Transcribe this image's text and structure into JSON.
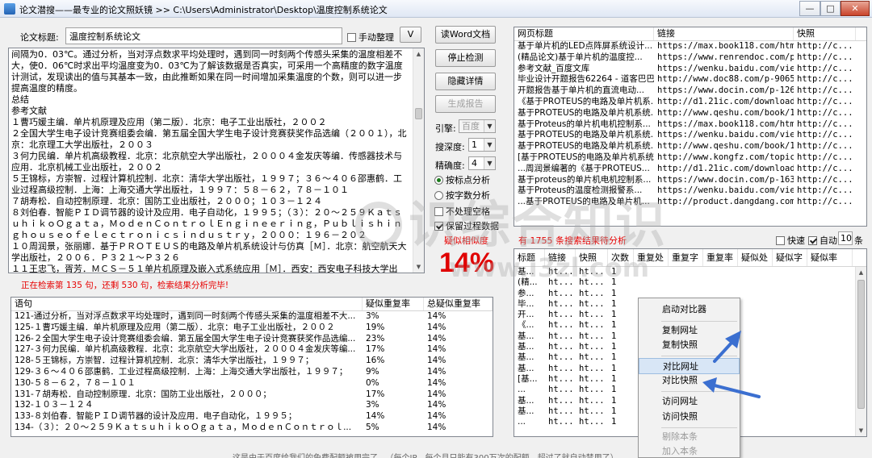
{
  "window": {
    "title": "论文潜搜——最专业的论文照妖镜 >> C:\\Users\\Administrator\\Desktop\\温度控制系统论文",
    "min": "—",
    "max": "□",
    "close": "✕"
  },
  "title_label": "论文标题:",
  "title_value": "温度控制系统论文",
  "manual_label": "手动整理",
  "v_button": "V",
  "article": {
    "lines": [
      "间隔为0．03℃。通过分析，当对浮点数求平均处理时，遇到同一时刻两个传感头采集的温度相差不大，使0．06℃时求出平均温度变为0．03℃为了解该数据是否真实，可采用一个高精度的数字温度计测试，发现读出的值与其基本一致，由此推断如果在同一时间增加采集温度的个数，则可以进一步提高温度的精度。",
      "总结",
      "参考文献",
      "１曹巧媛主编．单片机原理及应用（第二版）．北京：电子工业出版社，２００２",
      "２全国大学生电子设计竞赛组委会编．第五届全国大学生电子设计竞赛获奖作品选编（２００１），北京：北京理工大学出版社，２００３",
      "３何力民编．单片机高级教程．北京：北京航空大学出版社，２０００４金发庆等编．传感器技术与应用．北京机械工业出版社，２００２",
      "５王锦标，方崇智．过程计算机控制．北京：清华大学出版社，１９９７；３６～４０６邵惠鹤．工业过程高级控制．上海：上海交通大学出版社，１９９７：５８－６２，７８－１０１",
      "７胡寿松．自动控制原理．北京：国防工业出版社，２０００；１０３－１２４",
      "８刘伯春．智能ＰＩＤ调节器的设计及应用．电子自动化，１９９５；（３）：２０～２５９ＫａｔｓｕｈｉｋｏＯｇａｔａ，ＭｏｄｅｎＣｏｎｔｒｏｌＥｎｇｉｎｅｅｒｉｎｇ，Ｐｕｂｌｉｓｈｉｎｇｈｏｕｓｅｏｆｅｌｅｃｔｒｏｎｉｃｓｉｎｄｕｓｔｒｙ，２０００：１９６－２０２",
      "１０周润景，张丽娜．基于ＰＲＯＴＥＵＳ的电路及单片机系统设计与仿真［Ｍ］．北京：航空航天大学出版社，２００６．Ｐ３２１～Ｐ３２６",
      "１１王忠飞，胥芳．ＭＣＳ－５１单片机原理及嵌入式系统应用［Ｍ］．西安：西安电子科技大学出"
    ]
  },
  "status_text": "正在检索第 135 句，还剩 530 句，检索结果分析完毕!",
  "buttons": {
    "read_word": "读Word文档",
    "stop": "停止检测",
    "hide": "隐藏详情",
    "report": "生成报告"
  },
  "engine": {
    "label": "引擎:",
    "value": "百度"
  },
  "depth": {
    "label": "搜深度:",
    "value": "1"
  },
  "precision": {
    "label": "精确度:",
    "value": "4"
  },
  "radio_sentence": "按标点分析",
  "radio_chars": "按字数分析",
  "no_space": "不处理空格",
  "keep_data": "保留过程数据",
  "similarity_label": "疑似相似度",
  "similarity_value": "14%",
  "result_msg": "有 1755 条搜索结果待分析",
  "fast_label": "快速",
  "auto_label": "自动",
  "auto_count": "10",
  "auto_unit": "条",
  "sentence_table": {
    "headers": [
      "语句",
      "疑似重复率",
      "总疑似重复率"
    ],
    "rows": [
      [
        "121-通过分析，当对浮点数求平均处理时，遇到同一时刻两个传感头采集的温度相差不大...",
        "3%",
        "14%"
      ],
      [
        "125-１曹巧媛主编．单片机原理及应用（第二版）．北京：电子工业出版社，２００２",
        "19%",
        "14%"
      ],
      [
        "126-２全国大学生电子设计竞赛组委会编．第五届全国大学生电子设计竞赛获奖作品选编...",
        "23%",
        "14%"
      ],
      [
        "127-３何力民编．单片机高级教程．北京：北京航空大学出版社，２０００４金发庆等编...",
        "17%",
        "14%"
      ],
      [
        "128-５王锦标，方崇智．过程计算机控制．北京：清华大学出版社，１９９７；",
        "16%",
        "14%"
      ],
      [
        "129-３６～４０６邵惠鹤．工业过程高级控制．上海：上海交通大学出版社，１９９７；",
        "9%",
        "14%"
      ],
      [
        "130-５８－６２，７８－１０１",
        "0%",
        "14%"
      ],
      [
        "131-７胡寿松．自动控制原理．北京：国防工业出版社，２０００；",
        "17%",
        "14%"
      ],
      [
        "132-１０３－１２４",
        "3%",
        "14%"
      ],
      [
        "133-８刘伯春．智能ＰＩＤ调节器的设计及应用．电子自动化，１９９５；",
        "14%",
        "14%"
      ],
      [
        "134-（３）：２０～２５９ＫａｔｓｕｈｉｋｏＯｇａｔａ，ＭｏｄｅｎＣｏｎｔｒｏｌ...",
        "5%",
        "14%"
      ]
    ]
  },
  "web_table": {
    "headers": [
      "网页标题",
      "链接",
      "快照"
    ],
    "rows": [
      [
        "基于单片机的LED点阵屏系统设计...",
        "https://max.book118.com/html...",
        "http://c..."
      ],
      [
        "(精品论文)基于单片机的温度控...",
        "https://www.renrendoc.com/p-...",
        "http://c..."
      ],
      [
        "参考文献_百度文库",
        "https://wenku.baidu.com/view...",
        "http://c..."
      ],
      [
        "毕业设计开题报告62264 - 道客巴巴",
        "http://www.doc88.com/p-90651...",
        "http://c..."
      ],
      [
        "开题报告基于单片机的直流电动...",
        "https://www.docin.com/p-12695...",
        "http://c..."
      ],
      [
        "《基于PROTEUS的电路及单片机系...",
        "http://d1.21ic.com/download/...",
        "http://c..."
      ],
      [
        "基于PROTEUS的电路及单片机系统...",
        "http://www.qeshu.com/book/1...",
        "http://c..."
      ],
      [
        "基于Proteus的单片机电机控制系...",
        "https://max.book118.com/html...",
        "http://c..."
      ],
      [
        "基于PROTEUS的电路及单片机系统...",
        "https://wenku.baidu.com/view...",
        "http://c..."
      ],
      [
        "基于PROTEUS的电路及单片机系统...",
        "http://www.qeshu.com/book/1...",
        "http://c..."
      ],
      [
        "[基于PROTEUS的电路及单片机系统...",
        "http://www.kongfz.com/topic/...",
        "http://c..."
      ],
      [
        "...周润景编著的《基于PROTEUS...",
        "http://d1.21ic.com/download/...",
        "http://c..."
      ],
      [
        "基于proteus的单片机电机控制系...",
        "https://www.docin.com/p-1630...",
        "http://c..."
      ],
      [
        "基于Proteus的温度检测报警系...",
        "https://wenku.baidu.com/view...",
        "http://c..."
      ],
      [
        "...基于PROTEUS的电路及单片机...",
        "http://product.dangdang.com/...",
        "http://c..."
      ]
    ]
  },
  "detail_table": {
    "headers": [
      "标题",
      "链接",
      "快照",
      "次数",
      "重复处",
      "重复字",
      "重复率",
      "疑似处",
      "疑似字",
      "疑似率"
    ],
    "rows": [
      [
        "基...",
        "ht...",
        "ht...",
        "1"
      ],
      [
        "(精...",
        "ht...",
        "ht...",
        "1"
      ],
      [
        "参...",
        "ht...",
        "ht...",
        "1"
      ],
      [
        "毕...",
        "ht...",
        "ht...",
        "1"
      ],
      [
        "开...",
        "ht...",
        "ht...",
        "1"
      ],
      [
        "《...",
        "ht...",
        "ht...",
        "1"
      ],
      [
        "基...",
        "ht...",
        "ht...",
        "1"
      ],
      [
        "基...",
        "ht...",
        "ht...",
        "1"
      ],
      [
        "基...",
        "ht...",
        "ht...",
        "1"
      ],
      [
        "基...",
        "ht...",
        "ht...",
        "1"
      ],
      [
        "[基...",
        "ht...",
        "ht...",
        "1"
      ],
      [
        "...",
        "ht...",
        "ht...",
        "1"
      ],
      [
        "基...",
        "ht...",
        "ht...",
        "1"
      ],
      [
        "基...",
        "ht...",
        "ht...",
        "1"
      ],
      [
        "...",
        "ht...",
        "ht...",
        "1"
      ]
    ]
  },
  "context_menu": {
    "start_compare": "启动对比器",
    "copy_url": "复制网址",
    "copy_snapshot": "复制快照",
    "compare_url": "对比网址",
    "compare_snapshot": "对比快照",
    "visit_url": "访问网址",
    "visit_snapshot": "访问快照",
    "delete_item": "剔除本条",
    "add_item": "加入本条"
  },
  "watermark": {
    "brand": "识综合知识",
    "url": "www.i3zl.com"
  },
  "bottom_text": "这是由于百度给我们的免费配额被用完了...（每个IP，每个月只能有300万次的配额，超过了就自动禁用了）",
  "colors": {
    "accent_red": "#e60000",
    "arrow_blue": "#3b6fd0"
  }
}
